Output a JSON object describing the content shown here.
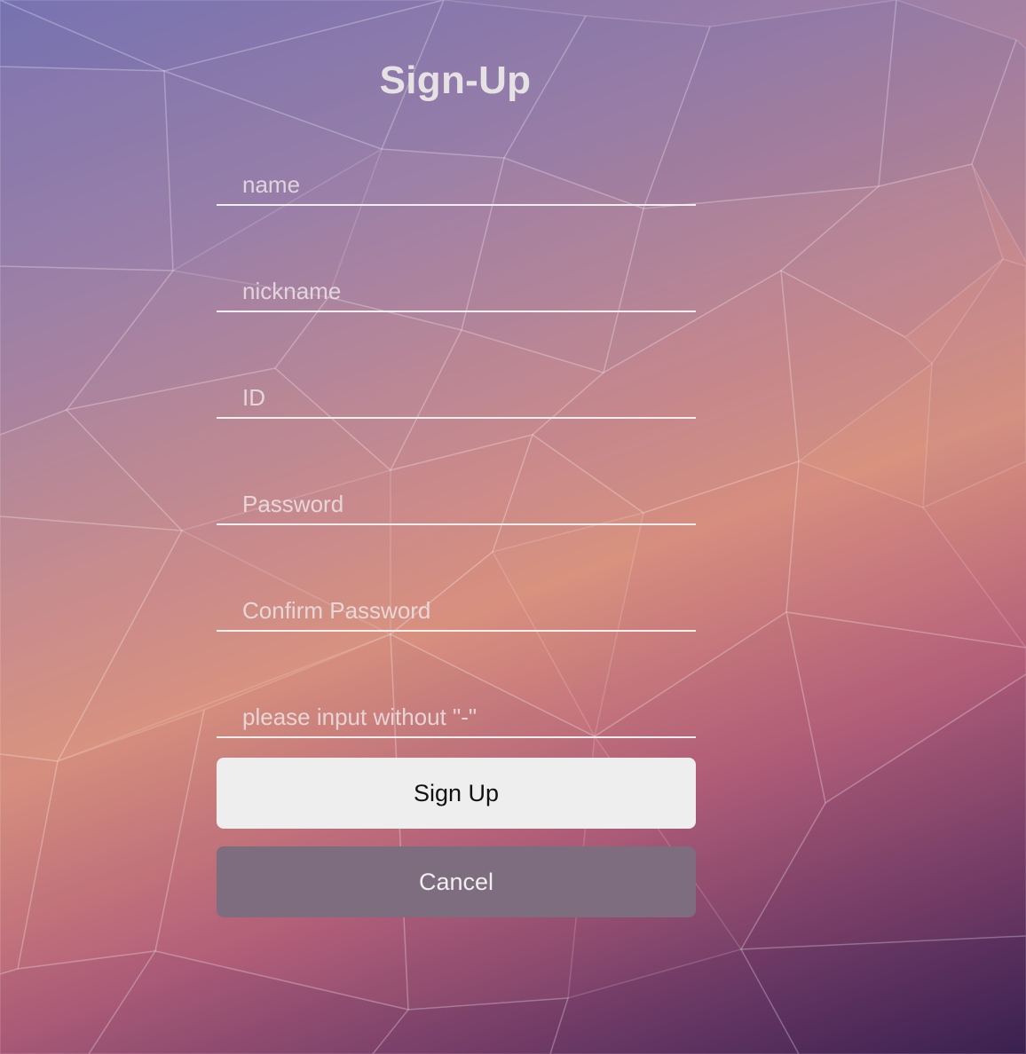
{
  "page": {
    "title": "Sign-Up"
  },
  "form": {
    "fields": [
      {
        "name": "name",
        "placeholder": "name",
        "value": ""
      },
      {
        "name": "nickname",
        "placeholder": "nickname",
        "value": ""
      },
      {
        "name": "id",
        "placeholder": "ID",
        "value": ""
      },
      {
        "name": "password",
        "placeholder": "Password",
        "value": ""
      },
      {
        "name": "confirm_password",
        "placeholder": "Confirm Password",
        "value": ""
      },
      {
        "name": "phone",
        "placeholder": "please input without \"-\"",
        "value": ""
      }
    ],
    "submit_label": "Sign Up",
    "cancel_label": "Cancel"
  },
  "colors": {
    "primary_button": "#efeeee",
    "secondary_button": "#7d6d7e",
    "title_text": "#e6e1e3"
  }
}
